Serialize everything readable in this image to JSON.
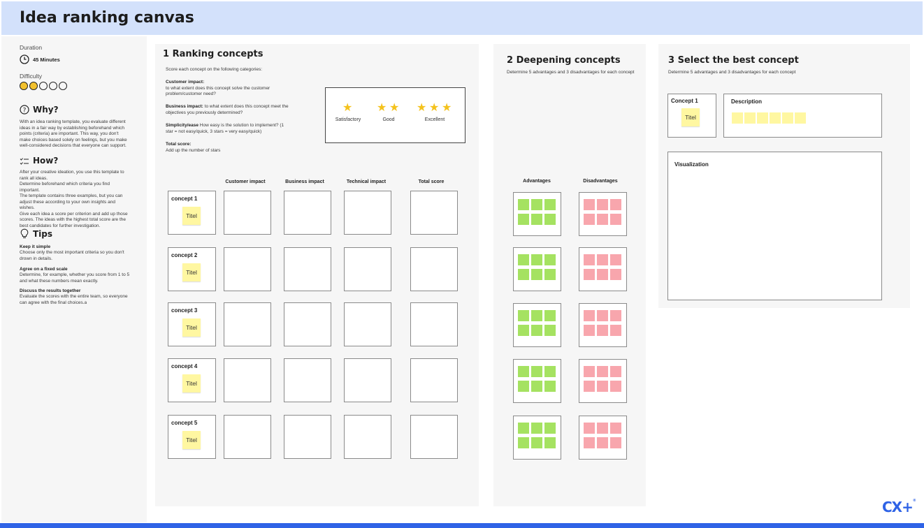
{
  "page": {
    "title": "Idea ranking canvas"
  },
  "sidebar": {
    "duration_label": "Duration",
    "duration_value": "45 Minutes",
    "difficulty_label": "Difficulty",
    "difficulty_level": 2,
    "difficulty_max": 5,
    "why_heading": "Why?",
    "why_text": "With an idea ranking template, you evaluate different ideas in a fair way by establishing beforehand which points (criteria) are important. This way, you don't make choices based solely on feelings, but you make well-considered decisions that everyone can support.",
    "how_heading": "How?",
    "how_text": "After your creative ideation, you use this template to rank all ideas.\nDetermine beforehand which criteria you find important.\nThe template contains three examples, but you can adjust these according to your own insights and wishes.\nGive each idea a score per criterion and add up those scores. The ideas with the highest total score are the best candidates for further investigation.",
    "tips_heading": "Tips",
    "tips": [
      {
        "title": "Keep it simple",
        "text": "Choose only the most important criteria so you don't drown in details."
      },
      {
        "title": "Agree on a fixed scale",
        "text": "Determine, for example, whether you score from 1 to 5 and what these numbers mean exactly."
      },
      {
        "title": "Discuss the results together",
        "text": "Evaluate the scores with the entire team, so everyone can agree with the final choices.a"
      }
    ]
  },
  "ranking": {
    "title": "1 Ranking concepts",
    "intro": "Score each concept on the following categories:",
    "criteria": [
      {
        "name": "Customer impact",
        "sep": ":",
        "desc": "to what extent does this concept solve the customer problem/customer need?",
        "inline": false
      },
      {
        "name": "Business impact",
        "sep": ":",
        "desc": "to what extent does this concept meet the objectives you previously determined?",
        "inline": true
      },
      {
        "name": "Simplicity/ease",
        "sep": "",
        "desc": "How easy is the solution to implement? (1 star = not easy/quick, 3 stars = very easy/quick)",
        "inline": true
      },
      {
        "name": "Total score",
        "sep": ":",
        "desc": "Add up the number of stars",
        "inline": false
      }
    ],
    "legend": [
      {
        "label": "Satisfactory",
        "stars": 1
      },
      {
        "label": "Good",
        "stars": 2
      },
      {
        "label": "Excellent",
        "stars": 3
      }
    ],
    "columns": [
      "Customer impact",
      "Business impact",
      "Technical impact",
      "Total score"
    ],
    "concepts": [
      {
        "name": "concept 1",
        "sticky": "Titel"
      },
      {
        "name": "concept 2",
        "sticky": "Titel"
      },
      {
        "name": "concept 3",
        "sticky": "Titel"
      },
      {
        "name": "concept 4",
        "sticky": "Titel"
      },
      {
        "name": "concept 5",
        "sticky": "Titel"
      }
    ]
  },
  "deepening": {
    "title": "2 Deepening concepts",
    "subtitle": "Determine 5 advantages and 3 disadvantages for each concept",
    "col_advantages": "Advantages",
    "col_disadvantages": "Disadvantages",
    "advantage_color": "#a5e261",
    "disadvantage_color": "#f8a6ad"
  },
  "select": {
    "title": "3 Select the best concept",
    "subtitle": "Determine 5 advantages and 3 disadvantages for each concept",
    "concept_label": "Concept 1",
    "concept_sticky": "Titel",
    "description_label": "Description",
    "visualization_label": "Visualization"
  },
  "brand": {
    "logo": "CX+",
    "accent": "#2f63e6",
    "header_bg": "#d3e1fb"
  }
}
